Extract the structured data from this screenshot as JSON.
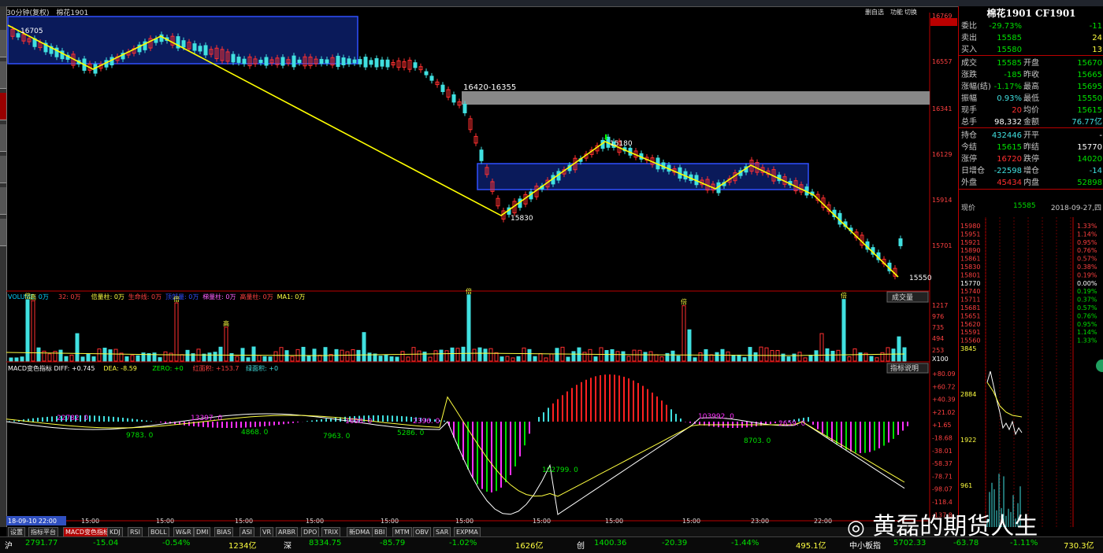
{
  "window": {
    "tab_label": "30分钟(复权)",
    "symbol_name": "棉花1901"
  },
  "main": {
    "price_axis": [
      "16769",
      "16740",
      "16557",
      "16341",
      "16129",
      "15914",
      "15701"
    ],
    "annotations": {
      "high_left": "16705",
      "zone_label": "16420-16355",
      "low_mid": "15830",
      "high_mid": "15180",
      "low_right": "15550"
    },
    "buttons": {
      "auto_select": "删自选",
      "contract_switch": "功能",
      "auto_toggle": "切换"
    }
  },
  "volume": {
    "legend": [
      {
        "text": "VOLUME: 0万",
        "color": "#00d0ff"
      },
      {
        "text": "32: 0万",
        "color": "#ff4040"
      },
      {
        "text": "倍量柱: 0万",
        "color": "#ffff40"
      },
      {
        "text": "生命线: 0万",
        "color": "#ff4040"
      },
      {
        "text": "顶部量: 0万",
        "color": "#3050ff"
      },
      {
        "text": "梯量柱: 0万",
        "color": "#ff60ff"
      },
      {
        "text": "高量柱: 0万",
        "color": "#ff4040"
      },
      {
        "text": "MA1: 0万",
        "color": "#ffff40"
      }
    ],
    "axis": [
      "1217",
      "976",
      "735",
      "494",
      "253",
      "X100"
    ],
    "menu_button": "成交量",
    "tag": "高",
    "tag_alt": "倍"
  },
  "macd": {
    "legend": [
      {
        "text": "MACD变色指标 DIFF: +0.745",
        "color": "#ffffff"
      },
      {
        "text": "DEA: -8.59",
        "color": "#ffff40"
      },
      {
        "text": "ZERO: +0",
        "color": "#00ff00"
      },
      {
        "text": "红面积: +153.7",
        "color": "#ff4040"
      },
      {
        "text": "绿面积: +0",
        "color": "#40e0e0"
      }
    ],
    "axis": [
      "+80.09",
      "+60.72",
      "+40.39",
      "+21.02",
      "+1.65",
      "-18.68",
      "-38.01",
      "-58.37",
      "-78.71",
      "-98.07",
      "-118.4",
      "-137.8"
    ],
    "help_button": "指标说明",
    "labels": [
      "22782. 0",
      "9783. 0",
      "13397. 0",
      "4868. 0",
      "1698. 0",
      "7963. 0",
      "2396. 0",
      "5286. 0",
      "102799. 0",
      "103992. 0",
      "8703. 0",
      "2659. 0"
    ]
  },
  "time_axis": {
    "start": "18-09-10 22:00",
    "ticks": [
      "15:00",
      "15:00",
      "15:00",
      "15:00",
      "15:00",
      "15:00",
      "15:00",
      "15:00",
      "15:00",
      "23:00",
      "22:00"
    ]
  },
  "tabs": [
    "设置",
    "指标平台",
    "MACD变色指标",
    "KDJ",
    "RSI",
    "BOLL",
    "W&R",
    "DMI",
    "BIAS",
    "ASI",
    "VR",
    "ARBR",
    "DPO",
    "TRIX",
    "新DMA",
    "BBI",
    "MTM",
    "OBV",
    "SAR",
    "EXPMA"
  ],
  "quote": {
    "title": "棉花1901 CF1901",
    "rows": [
      {
        "l": "委比",
        "v": "-29.73%",
        "vc": "green",
        "l2": "",
        "v2": "-11",
        "v2c": "green"
      },
      {
        "l": "卖出",
        "v": "15585",
        "vc": "green",
        "l2": "",
        "v2": "24",
        "v2c": "yel"
      },
      {
        "l": "买入",
        "v": "15580",
        "vc": "green",
        "l2": "",
        "v2": "13",
        "v2c": "yel"
      },
      {
        "l": "成交",
        "v": "15585",
        "vc": "green",
        "l2": "开盘",
        "v2": "15670",
        "v2c": "green"
      },
      {
        "l": "涨跌",
        "v": "-185",
        "vc": "green",
        "l2": "昨收",
        "v2": "15665",
        "v2c": "green"
      },
      {
        "l": "涨幅(结)",
        "v": "-1.17%",
        "vc": "green",
        "l2": "最高",
        "v2": "15695",
        "v2c": "green"
      },
      {
        "l": "振幅",
        "v": "0.93%",
        "vc": "cyan",
        "l2": "最低",
        "v2": "15550",
        "v2c": "green"
      },
      {
        "l": "现手",
        "v": "20",
        "vc": "red",
        "l2": "均价",
        "v2": "15615",
        "v2c": "green"
      },
      {
        "l": "总手",
        "v": "98,332",
        "vc": "wht",
        "l2": "金额",
        "v2": "76.77亿",
        "v2c": "cyan"
      },
      {
        "l": "持仓",
        "v": "432446",
        "vc": "cyan",
        "l2": "开平",
        "v2": "-",
        "v2c": "wht"
      },
      {
        "l": "今结",
        "v": "15615",
        "vc": "green",
        "l2": "昨结",
        "v2": "15770",
        "v2c": "wht"
      },
      {
        "l": "涨停",
        "v": "16720",
        "vc": "red",
        "l2": "跌停",
        "v2": "14020",
        "v2c": "green"
      },
      {
        "l": "日增仓",
        "v": "-22598",
        "vc": "cyan",
        "l2": "增仓",
        "v2": "-14",
        "v2c": "cyan"
      },
      {
        "l": "外盘",
        "v": "45434",
        "vc": "red",
        "l2": "内盘",
        "v2": "52898",
        "v2c": "green"
      }
    ],
    "now_label": "现价",
    "now_value": "15585",
    "date": "2018-09-27,四",
    "mini_left": [
      "15980",
      "15951",
      "15921",
      "15890",
      "15861",
      "15830",
      "15801",
      "15770",
      "15740",
      "15711",
      "15681",
      "15651",
      "15620",
      "15591",
      "15560",
      "3845",
      "2884",
      "1922",
      "961"
    ],
    "mini_right": [
      "1.33%",
      "1.14%",
      "0.95%",
      "0.76%",
      "0.57%",
      "0.38%",
      "0.19%",
      "0.00%",
      "0.19%",
      "0.37%",
      "0.57%",
      "0.76%",
      "0.95%",
      "1.14%",
      "1.33%"
    ]
  },
  "statusbar": [
    {
      "t": "沪",
      "c": "wht"
    },
    {
      "t": "2791.77",
      "c": "green"
    },
    {
      "t": "-15.04",
      "c": "green"
    },
    {
      "t": "-0.54%",
      "c": "green"
    },
    {
      "t": "1234亿",
      "c": "yel"
    },
    {
      "t": "深",
      "c": "wht"
    },
    {
      "t": "8334.75",
      "c": "green"
    },
    {
      "t": "-85.79",
      "c": "green"
    },
    {
      "t": "-1.02%",
      "c": "green"
    },
    {
      "t": "1626亿",
      "c": "yel"
    },
    {
      "t": "创",
      "c": "wht"
    },
    {
      "t": "1400.36",
      "c": "green"
    },
    {
      "t": "-20.39",
      "c": "green"
    },
    {
      "t": "-1.44%",
      "c": "green"
    },
    {
      "t": "495.1亿",
      "c": "yel"
    },
    {
      "t": "中小板指",
      "c": "wht"
    },
    {
      "t": "5702.33",
      "c": "green"
    },
    {
      "t": "-63.78",
      "c": "green"
    },
    {
      "t": "-1.11%",
      "c": "green"
    },
    {
      "t": "730.3亿",
      "c": "yel"
    }
  ],
  "watermark": "黄磊的期货人生"
}
